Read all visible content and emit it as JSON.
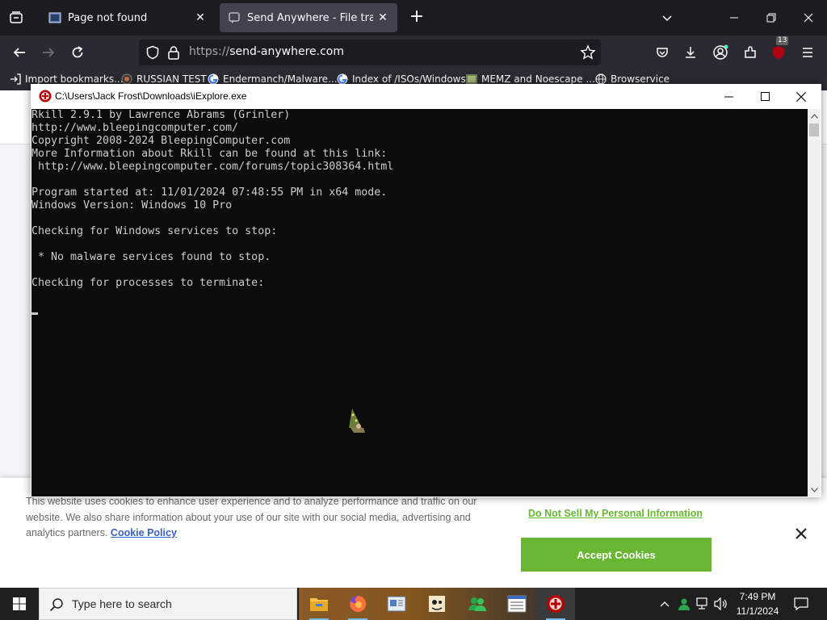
{
  "browser": {
    "tabs": [
      {
        "title": "Page not found",
        "active": false
      },
      {
        "title": "Send Anywhere - File transfer",
        "active": true
      }
    ],
    "url": {
      "scheme": "https://",
      "host": "send-anywhere.com"
    },
    "extension_badge": "13",
    "bookmarks": [
      {
        "label": "Import bookmarks...",
        "icon": "import-icon"
      },
      {
        "label": "RUSSIAN TEST",
        "icon": "globe-icon"
      },
      {
        "label": "Endermanch/Malware...",
        "icon": "google-icon"
      },
      {
        "label": "Index of /ISOs/Windows",
        "icon": "google-icon"
      },
      {
        "label": "MEMZ and Noescape ...",
        "icon": "image-icon"
      },
      {
        "label": "Browservice",
        "icon": "globe-icon"
      }
    ]
  },
  "console": {
    "title": "C:\\Users\\Jack Frost\\Downloads\\iExplore.exe",
    "lines": [
      "Rkill 2.9.1 by Lawrence Abrams (Grinler)",
      "http://www.bleepingcomputer.com/",
      "Copyright 2008-2024 BleepingComputer.com",
      "More Information about Rkill can be found at this link:",
      " http://www.bleepingcomputer.com/forums/topic308364.html",
      "",
      "Program started at: 11/01/2024 07:48:55 PM in x64 mode.",
      "Windows Version: Windows 10 Pro",
      "",
      "Checking for Windows services to stop:",
      "",
      " * No malware services found to stop.",
      "",
      "Checking for processes to terminate:"
    ]
  },
  "cookie_banner": {
    "text_before_link": "This website uses cookies to enhance user experience and to analyze performance and traffic on our website. We also share information about your use of our site with our social media, advertising and analytics partners.",
    "policy_link": "Cookie Policy",
    "do_not_sell": "Do Not Sell My Personal Information",
    "accept": "Accept Cookies",
    "colors": {
      "accent": "#68b631",
      "link": "#3860be"
    }
  },
  "taskbar": {
    "search_placeholder": "Type here to search",
    "time": "7:49 PM",
    "date": "11/1/2024",
    "apps": [
      "file-explorer-icon",
      "firefox-icon",
      "document-viewer-icon",
      "game-icon",
      "users-icon",
      "list-app-icon",
      "rkill-icon"
    ]
  }
}
